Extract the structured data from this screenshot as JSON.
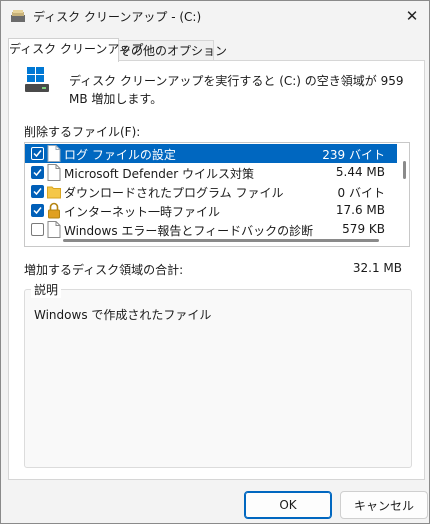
{
  "window": {
    "title": "ディスク クリーンアップ - (C:)",
    "close_glyph": "✕"
  },
  "tabs": [
    {
      "label": "ディスク クリーンアップ",
      "active": true
    },
    {
      "label": "その他のオプション",
      "active": false
    }
  ],
  "intro_text": "ディスク クリーンアップを実行すると (C:) の空き領域が 959 MB 増加します。",
  "list_label": "削除するファイル(F):",
  "files": [
    {
      "name": "ログ ファイルの設定",
      "size": "239 バイト",
      "checked": true,
      "selected": true,
      "icon": "document-icon"
    },
    {
      "name": "Microsoft Defender ウイルス対策",
      "size": "5.44 MB",
      "checked": true,
      "selected": false,
      "icon": "document-icon"
    },
    {
      "name": "ダウンロードされたプログラム ファイル",
      "size": "0 バイト",
      "checked": true,
      "selected": false,
      "icon": "folder-icon"
    },
    {
      "name": "インターネット一時ファイル",
      "size": "17.6 MB",
      "checked": true,
      "selected": false,
      "icon": "lock-icon"
    },
    {
      "name": "Windows エラー報告とフィードバックの診断",
      "size": "579 KB",
      "checked": false,
      "selected": false,
      "icon": "document-icon"
    }
  ],
  "total": {
    "label": "増加するディスク領域の合計:",
    "value": "32.1 MB"
  },
  "description": {
    "legend": "説明",
    "text": "Windows で作成されたファイル"
  },
  "buttons": {
    "ok": "OK",
    "cancel": "キャンセル"
  },
  "colors": {
    "accent": "#0067c0",
    "checkbox": "#005fb8",
    "folder": "#f5c748",
    "lock": "#e0a020"
  }
}
